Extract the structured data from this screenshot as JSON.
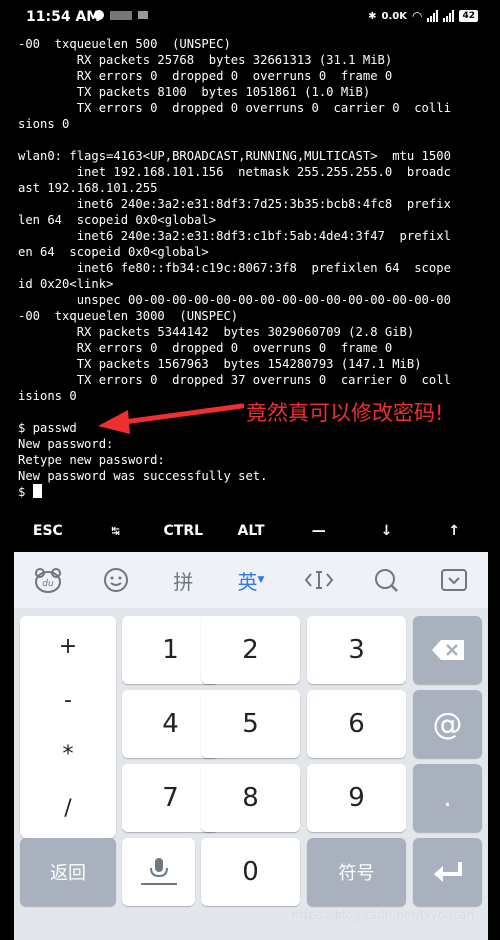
{
  "status_bar": {
    "time": "11:54 AM",
    "speed": "0.0K",
    "battery": "42"
  },
  "terminal": {
    "lines": [
      "-00  txqueuelen 500  (UNSPEC)",
      "        RX packets 25768  bytes 32661313 (31.1 MiB)",
      "        RX errors 0  dropped 0  overruns 0  frame 0",
      "        TX packets 8100  bytes 1051861 (1.0 MiB)",
      "        TX errors 0  dropped 0 overruns 0  carrier 0  colli",
      "sions 0",
      "",
      "wlan0: flags=4163<UP,BROADCAST,RUNNING,MULTICAST>  mtu 1500",
      "        inet 192.168.101.156  netmask 255.255.255.0  broadc",
      "ast 192.168.101.255",
      "        inet6 240e:3a2:e31:8df3:7d25:3b35:bcb8:4fc8  prefix",
      "len 64  scopeid 0x0<global>",
      "        inet6 240e:3a2:e31:8df3:c1bf:5ab:4de4:3f47  prefixl",
      "en 64  scopeid 0x0<global>",
      "        inet6 fe80::fb34:c19c:8067:3f8  prefixlen 64  scope",
      "id 0x20<link>",
      "        unspec 00-00-00-00-00-00-00-00-00-00-00-00-00-00-00",
      "-00  txqueuelen 3000  (UNSPEC)",
      "        RX packets 5344142  bytes 3029060709 (2.8 GiB)",
      "        RX errors 0  dropped 0  overruns 0  frame 0",
      "        TX packets 1567963  bytes 154280793 (147.1 MiB)",
      "        TX errors 0  dropped 37 overruns 0  carrier 0  coll",
      "isions 0",
      "",
      "$ passwd",
      "New password:",
      "Retype new password:",
      "New password was successfully set."
    ],
    "prompt": "$ "
  },
  "annotation": "竟然真可以修改密码!",
  "extra_keys": [
    "ESC",
    "↹",
    "CTRL",
    "ALT",
    "—",
    "↓",
    "↑"
  ],
  "ime_toolbar": {
    "pinyin_label": "拼",
    "english_label": "英"
  },
  "keypad": {
    "symbols": [
      "+",
      "-",
      "*",
      "/"
    ],
    "digits": [
      "1",
      "2",
      "3",
      "4",
      "5",
      "6",
      "7",
      "8",
      "9",
      "0"
    ],
    "at": "@",
    "dot": ".",
    "back_label": "返回",
    "symbol_label": "符号"
  },
  "watermark": "https://blog.csdn.net/lxyoucan"
}
